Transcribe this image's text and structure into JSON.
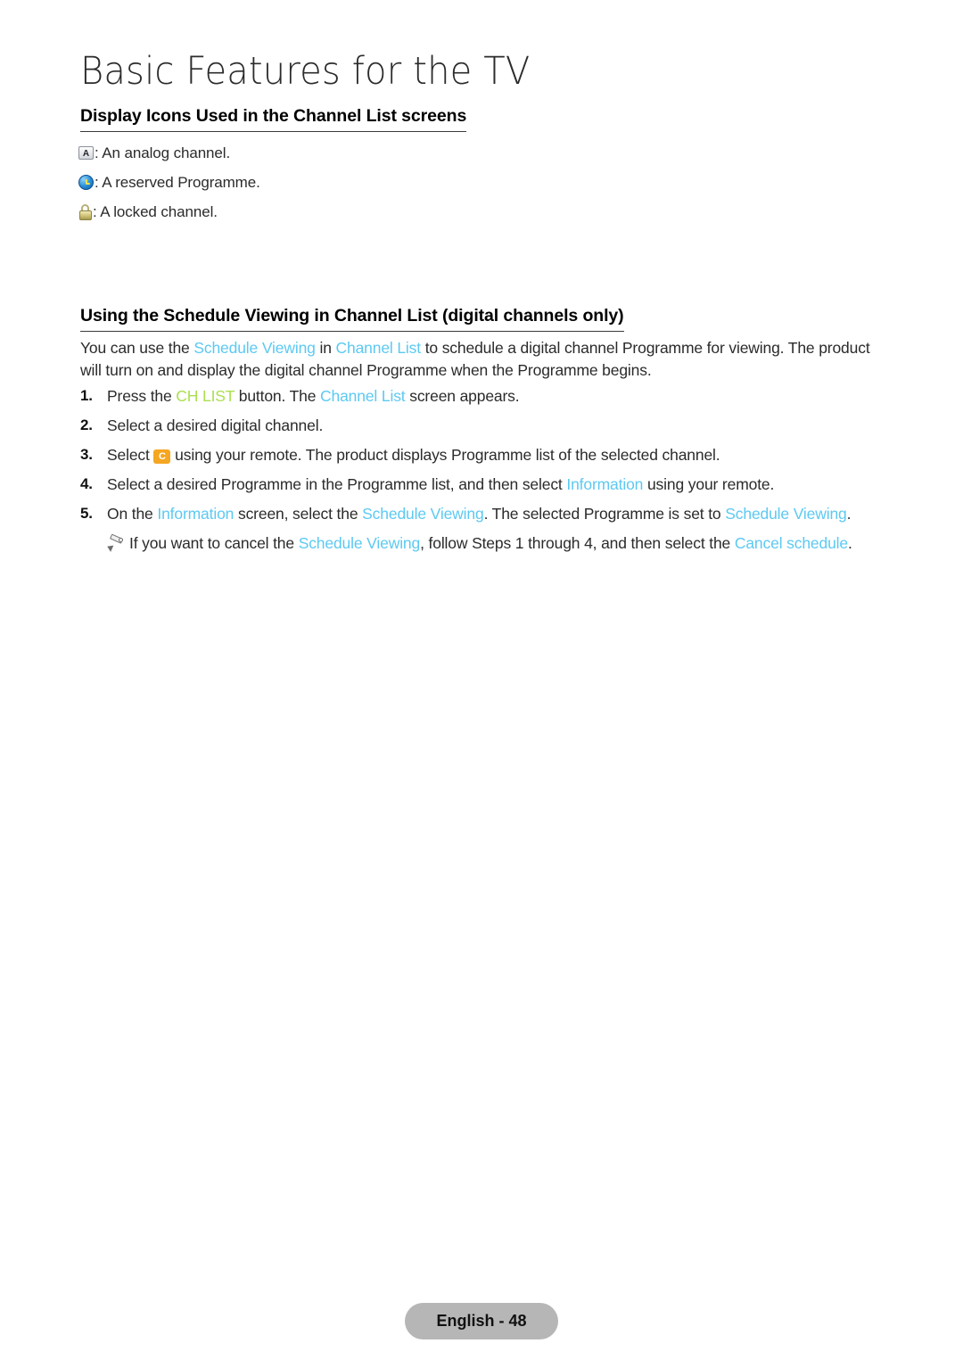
{
  "page": {
    "chapter_title": "Basic Features for the TV",
    "footer_label": "English - 48"
  },
  "colors": {
    "osd_cyan": "#5cc9f2",
    "key_green": "#aadf4e",
    "color_button_orange": "#f5a623",
    "footer_pill_grey": "#b6b6b6",
    "body_text": "#2b2b2b"
  },
  "sections": {
    "display_icons": {
      "heading": "Display Icons Used in the Channel List screens",
      "legend": [
        {
          "icon": "analog-channel-icon",
          "icon_label": "A",
          "text": ": An analog channel."
        },
        {
          "icon": "reserved-programme-clock-icon",
          "icon_label": "",
          "text": ": A reserved Programme."
        },
        {
          "icon": "locked-channel-lock-icon",
          "icon_label": "",
          "text": ": A locked channel."
        }
      ]
    },
    "schedule_viewing": {
      "heading": "Using the Schedule Viewing in Channel List (digital channels only)",
      "paragraph": {
        "p1": "You can use the ",
        "link1": "Schedule Viewing",
        "p2": " in ",
        "link2": "Channel List",
        "p3": " to schedule a digital channel Programme for viewing. The product will turn on and display the digital channel Programme when the Programme begins."
      },
      "steps": [
        {
          "num": "1.",
          "parts": {
            "t1": "Press the ",
            "key": "CH LIST",
            "t2": " button. The ",
            "link": "Channel List",
            "t3": " screen appears."
          }
        },
        {
          "num": "2.",
          "parts": {
            "t1": "Select a desired digital channel."
          }
        },
        {
          "num": "3.",
          "parts": {
            "t1": "Select ",
            "button": "C",
            "t2": " using your remote. The product displays Programme list of the selected channel."
          }
        },
        {
          "num": "4.",
          "parts": {
            "t1": "Select a desired Programme in the Programme list, and then select ",
            "link": "Information",
            "t2": " using your remote."
          }
        },
        {
          "num": "5.",
          "parts": {
            "t1": "On the ",
            "link1": "Information",
            "t2": " screen, select the ",
            "link2": "Schedule Viewing",
            "t3": ". The selected Programme is set to ",
            "link3": "Schedule Viewing",
            "t4": "."
          }
        }
      ],
      "note": {
        "icon": "pencil-note-icon",
        "t1": "If you want to cancel the ",
        "link1": "Schedule Viewing",
        "t2": ", follow Steps 1 through 4, and then select the ",
        "link2": "Cancel schedule",
        "t3": "."
      }
    }
  }
}
